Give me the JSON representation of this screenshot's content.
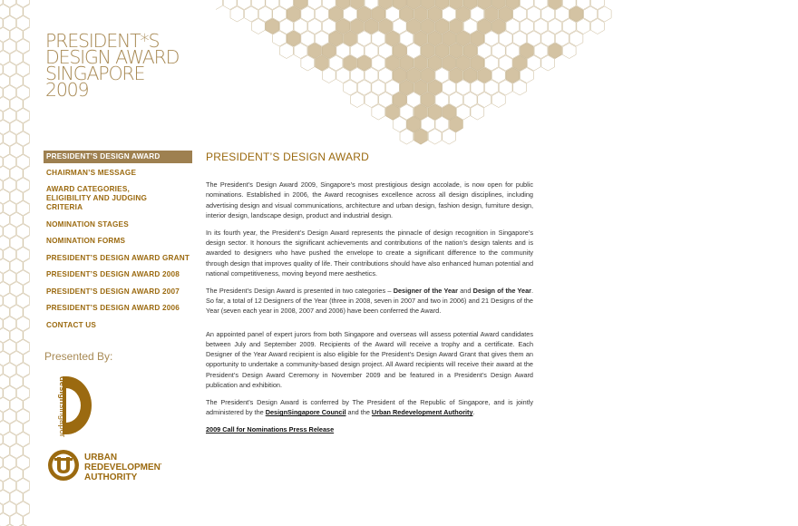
{
  "logo": {
    "lines": [
      "PRESIDENT*S",
      "DESIGN AWARD",
      "SINGAPORE",
      "2009"
    ]
  },
  "nav": {
    "items": [
      {
        "label": "PRESIDENT’S DESIGN AWARD",
        "active": true
      },
      {
        "label": "CHAIRMAN’S MESSAGE"
      },
      {
        "label": "AWARD CATEGORIES, ELIGIBILITY AND JUDGING CRITERIA"
      },
      {
        "label": "NOMINATION STAGES"
      },
      {
        "label": "NOMINATION FORMS"
      },
      {
        "label": "PRESIDENT’S DESIGN AWARD GRANT"
      },
      {
        "label": "PRESIDENT’S DESIGN AWARD 2008"
      },
      {
        "label": "PRESIDENT’S DESIGN AWARD 2007"
      },
      {
        "label": "PRESIDENT’S DESIGN AWARD 2006"
      },
      {
        "label": "CONTACT US"
      }
    ]
  },
  "sponsors": {
    "presented_by": "Presented By:",
    "design_singapore": {
      "word1": "design",
      "word2": "singapore"
    },
    "ura": {
      "lines": [
        "URBAN",
        "REDEVELOPMENT",
        "AUTHORITY"
      ]
    }
  },
  "main": {
    "title": "PRESIDENT’S DESIGN AWARD",
    "p1": "The President’s Design Award 2009, Singapore’s most prestigious design accolade, is now open for public nominations. Established in 2006, the Award recognises excellence across all design disciplines, including advertising design and visual communications, architecture and urban design, fashion design, furniture design, interior design, landscape design, product and industrial design.",
    "p2": "In its fourth year, the President’s Design Award represents the pinnacle of design recognition in Singapore’s design sector. It honours the significant achievements and contributions of the nation’s design talents and is awarded to designers who have pushed the envelope to create a significant difference to the community through design that improves quality of life. Their contributions should have also enhanced human potential and national competitiveness, moving beyond mere aesthetics.",
    "p3_a": "The President’s Design Award is presented in two categories – ",
    "p3_b1": "Designer of the Year",
    "p3_c": " and ",
    "p3_b2": "Design of the Year",
    "p3_d": ". So far, a total of 12 Designers of the Year (three in 2008, seven in 2007 and two in 2006) and 21 Designs of the Year (seven each year in 2008, 2007 and 2006) have been conferred the Award.",
    "p4": "An appointed panel of expert jurors from both Singapore and overseas will assess potential Award candidates between July and September 2009. Recipients of the Award will receive a trophy and a certificate. Each Designer of the Year Award recipient is also eligible for the President’s Design Award Grant that gives them an opportunity to undertake a community-based design project. All Award recipients will receive their award at the President’s Design Award Ceremony in November 2009 and be featured in a President’s Design Award publication and exhibition.",
    "p5_a": "The President’s Design Award is conferred by The President of the Republic of Singapore, and is jointly administered by the ",
    "p5_link1": "DesignSingapore Council",
    "p5_b": " and the ",
    "p5_link2": "Urban Redevelopment Authority",
    "p5_c": ".",
    "press_link": "2009 Call for Nominations Press Release"
  },
  "colors": {
    "accent": "#9b6a10",
    "gold": "#a88a55",
    "hex_fill": "#d4c3a3",
    "hex_line": "#c9b896"
  }
}
